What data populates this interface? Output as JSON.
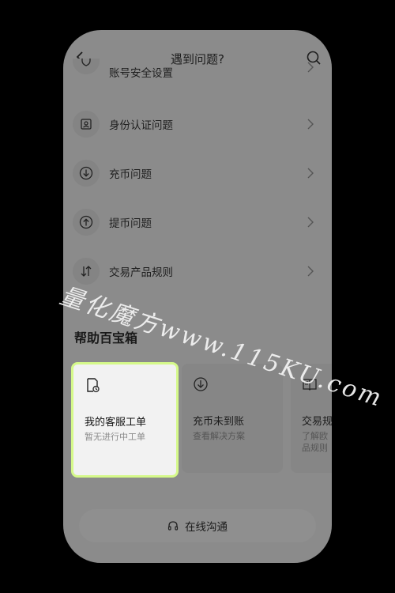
{
  "header": {
    "title": "遇到问题?"
  },
  "menu": {
    "partial_top_label": "账号安全设置",
    "items": [
      {
        "label": "身份认证问题",
        "icon": "id-card-icon"
      },
      {
        "label": "充币问题",
        "icon": "deposit-icon"
      },
      {
        "label": "提币问题",
        "icon": "withdraw-icon"
      },
      {
        "label": "交易产品规则",
        "icon": "swap-icon"
      }
    ]
  },
  "help_box": {
    "title": "帮助百宝箱",
    "cards": [
      {
        "title": "我的客服工单",
        "subtitle": "暂无进行中工单",
        "icon": "ticket-icon"
      },
      {
        "title": "充币未到账",
        "subtitle": "查看解决方案",
        "icon": "deposit-icon"
      },
      {
        "title": "交易规",
        "subtitle": "了解欧\n品规则",
        "icon": "book-icon"
      }
    ]
  },
  "bottom": {
    "label": "在线沟通",
    "icon": "headset-icon"
  },
  "watermark": "量化魔方www.115KU.com",
  "colors": {
    "highlight_border": "#d5f98a",
    "overlay": "#8b8b8b"
  }
}
